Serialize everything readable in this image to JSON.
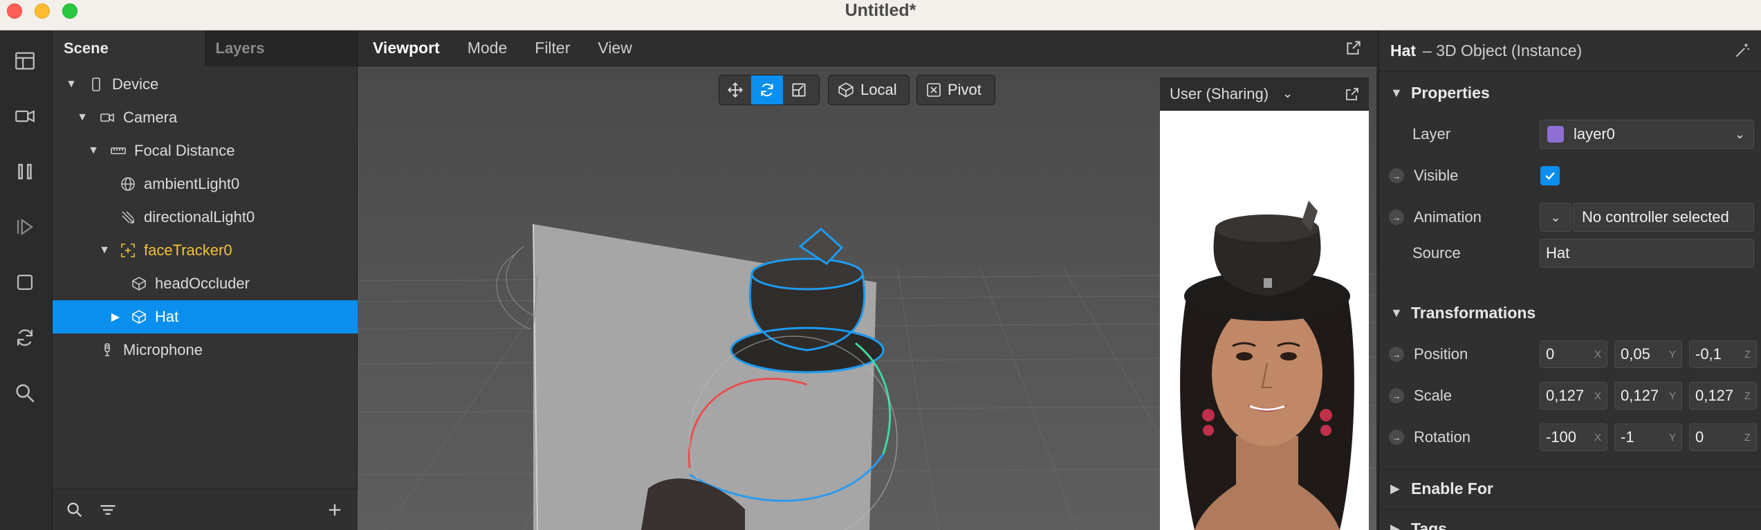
{
  "window": {
    "title": "Untitled*"
  },
  "rail": {
    "icons": [
      "layout-icon",
      "video-camera-icon",
      "pause-icon",
      "play-step-icon",
      "stop-icon",
      "refresh-icon",
      "search-icon"
    ]
  },
  "scene_panel": {
    "tabs": [
      {
        "label": "Scene"
      },
      {
        "label": "Layers"
      }
    ],
    "tree": [
      {
        "label": "Device",
        "icon": "device-icon",
        "expanded": true
      },
      {
        "label": "Camera",
        "icon": "camera-icon",
        "expanded": true
      },
      {
        "label": "Focal Distance",
        "icon": "ruler-icon",
        "expanded": true
      },
      {
        "label": "ambientLight0",
        "icon": "globe-light-icon"
      },
      {
        "label": "directionalLight0",
        "icon": "directional-light-icon"
      },
      {
        "label": "faceTracker0",
        "icon": "face-tracker-icon",
        "expanded": true,
        "color": "#f0c23a"
      },
      {
        "label": "headOccluder",
        "icon": "cube-icon"
      },
      {
        "label": "Hat",
        "icon": "cube-icon",
        "collapsed": true,
        "selected": true
      },
      {
        "label": "Microphone",
        "icon": "microphone-icon"
      }
    ]
  },
  "viewport": {
    "menu": [
      "Viewport",
      "Mode",
      "Filter",
      "View"
    ],
    "toolbar": {
      "local_label": "Local",
      "pivot_label": "Pivot"
    },
    "simulator": {
      "device_label": "User (Sharing)"
    }
  },
  "inspector": {
    "object_name": "Hat",
    "object_type": "– 3D Object (Instance)",
    "sections": {
      "properties": "Properties",
      "transformations": "Transformations",
      "enable_for": "Enable For",
      "tags": "Tags"
    },
    "properties": {
      "layer_label": "Layer",
      "layer_value": "layer0",
      "layer_color": "#8e6fd4",
      "visible_label": "Visible",
      "visible_checked": true,
      "animation_label": "Animation",
      "animation_value": "No controller selected",
      "source_label": "Source",
      "source_value": "Hat"
    },
    "transformations": {
      "position_label": "Position",
      "position": {
        "x": "0",
        "y": "0,05",
        "z": "-0,1"
      },
      "scale_label": "Scale",
      "scale": {
        "x": "0,127",
        "y": "0,127",
        "z": "0,127"
      },
      "rotation_label": "Rotation",
      "rotation": {
        "x": "-100",
        "y": "-1",
        "z": "0"
      },
      "axis": {
        "x": "X",
        "y": "Y",
        "z": "Z"
      }
    }
  },
  "colors": {
    "accent": "#0a8fef",
    "warning": "#f0c23a"
  }
}
